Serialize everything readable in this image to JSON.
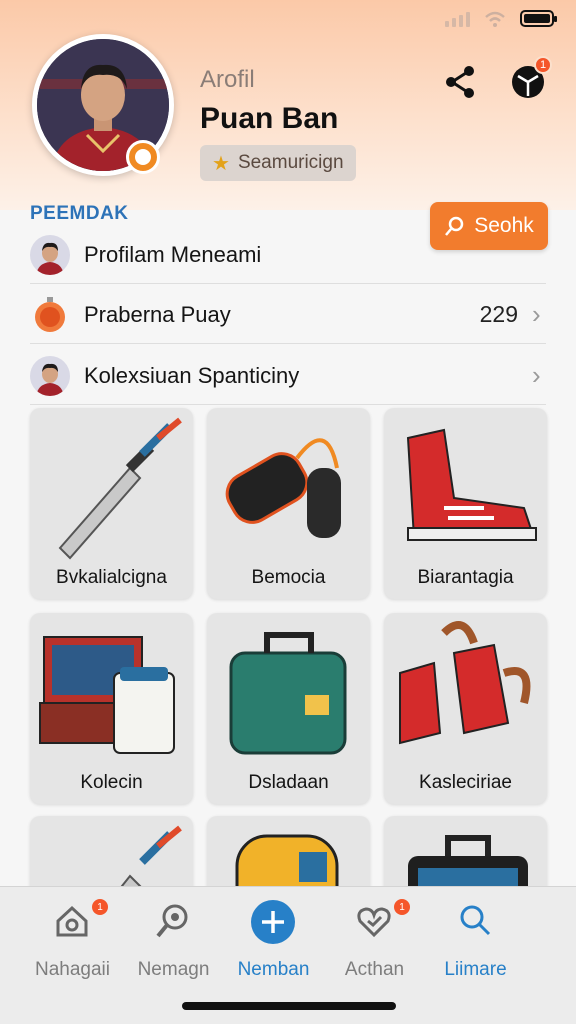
{
  "header": {
    "subtitle": "Arofil",
    "name": "Puan Ban",
    "pill_label": "Seamuricign",
    "share_icon": "share-icon",
    "notification_badge": "1"
  },
  "section": {
    "label": "PEEMDAK",
    "search_label": "Seohk"
  },
  "list": [
    {
      "label": "Profilam Meneami",
      "count": ""
    },
    {
      "label": "Praberna Puay",
      "count": "229"
    },
    {
      "label": "Kolexsiuan Spanticiny",
      "count": ""
    }
  ],
  "cards": [
    {
      "label": "Bvkalialcigna",
      "icon": "sword-icon"
    },
    {
      "label": "Bemocia",
      "icon": "punching-bag-icon"
    },
    {
      "label": "Biarantagia",
      "icon": "sneaker-icon"
    },
    {
      "label": "Kolecin",
      "icon": "laptop-icon"
    },
    {
      "label": "Dsladaan",
      "icon": "toolbox-icon"
    },
    {
      "label": "Kasleciriae",
      "icon": "boots-icon"
    },
    {
      "label": "",
      "icon": "sword-icon"
    },
    {
      "label": "",
      "icon": "backpack-icon"
    },
    {
      "label": "",
      "icon": "case-icon"
    }
  ],
  "tabs": [
    {
      "label": "Nahagaii",
      "icon": "home-icon",
      "badge": "1"
    },
    {
      "label": "Nemagn",
      "icon": "search-icon",
      "badge": ""
    },
    {
      "label": "Nemban",
      "icon": "plus-icon",
      "badge": ""
    },
    {
      "label": "Acthan",
      "icon": "heart-icon",
      "badge": "1"
    },
    {
      "label": "Liimare",
      "icon": "magnify-icon",
      "badge": ""
    }
  ],
  "colors": {
    "accent_orange": "#f27c2d",
    "accent_blue": "#2780c8",
    "badge_red": "#f5562a"
  }
}
